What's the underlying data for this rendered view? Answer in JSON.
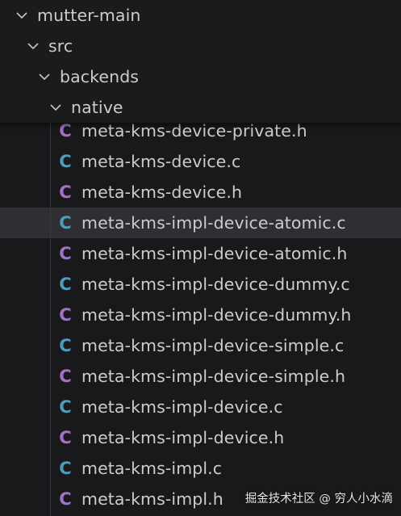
{
  "colors": {
    "c_source": "#519aba",
    "h_header": "#a074c4",
    "selected_row": "#2f2f33"
  },
  "tree": {
    "folders": [
      {
        "label": "mutter-main",
        "icon": "chevron-down-icon"
      },
      {
        "label": "src",
        "icon": "chevron-down-icon"
      },
      {
        "label": "backends",
        "icon": "chevron-down-icon"
      },
      {
        "label": "native",
        "icon": "chevron-down-icon"
      }
    ],
    "files": [
      {
        "icon_letter": "C",
        "type": "h",
        "label": "meta-kms-device-private.h"
      },
      {
        "icon_letter": "C",
        "type": "c",
        "label": "meta-kms-device.c"
      },
      {
        "icon_letter": "C",
        "type": "h",
        "label": "meta-kms-device.h"
      },
      {
        "icon_letter": "C",
        "type": "c",
        "label": "meta-kms-impl-device-atomic.c",
        "selected": true
      },
      {
        "icon_letter": "C",
        "type": "h",
        "label": "meta-kms-impl-device-atomic.h"
      },
      {
        "icon_letter": "C",
        "type": "c",
        "label": "meta-kms-impl-device-dummy.c"
      },
      {
        "icon_letter": "C",
        "type": "h",
        "label": "meta-kms-impl-device-dummy.h"
      },
      {
        "icon_letter": "C",
        "type": "c",
        "label": "meta-kms-impl-device-simple.c"
      },
      {
        "icon_letter": "C",
        "type": "h",
        "label": "meta-kms-impl-device-simple.h"
      },
      {
        "icon_letter": "C",
        "type": "c",
        "label": "meta-kms-impl-device.c"
      },
      {
        "icon_letter": "C",
        "type": "h",
        "label": "meta-kms-impl-device.h"
      },
      {
        "icon_letter": "C",
        "type": "c",
        "label": "meta-kms-impl.c"
      },
      {
        "icon_letter": "C",
        "type": "h",
        "label": "meta-kms-impl.h"
      }
    ]
  },
  "watermark": "掘金技术社区 @ 穷人小水滴"
}
